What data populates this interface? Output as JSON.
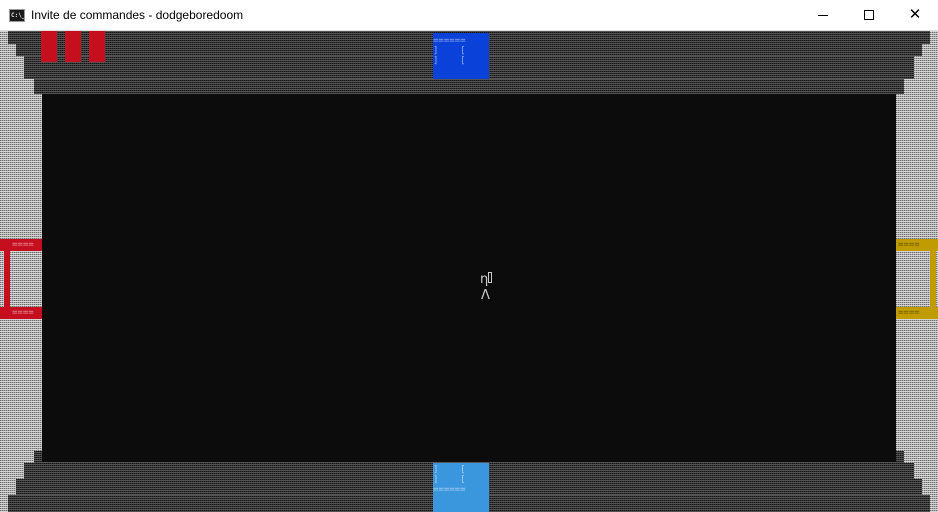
{
  "window": {
    "icon": "console-icon",
    "icon_text": "C:\\_",
    "title": "Invite de commandes - dodgeboredoom",
    "controls": {
      "minimize": "minimize-icon",
      "maximize": "maximize-icon",
      "close": "close-icon",
      "close_glyph": "✕"
    }
  },
  "game": {
    "player": {
      "head": "η",
      "body": "Λ"
    },
    "lives": 3,
    "doors": {
      "top": {
        "color": "#0a41d8",
        "glyph": "======\n]    [\n]    ["
      },
      "bottom": {
        "color": "#3a96dd",
        "glyph": "]    [\n]    [\n======"
      },
      "left": {
        "color": "#c50f1f",
        "glyph": "===="
      },
      "right": {
        "color": "#c19c00",
        "glyph": "===="
      }
    },
    "colors": {
      "background": "#0c0c0c",
      "wall_light": "#a8a8a8",
      "wall_dark": "#2f2f2f",
      "life": "#c50f1f"
    }
  }
}
